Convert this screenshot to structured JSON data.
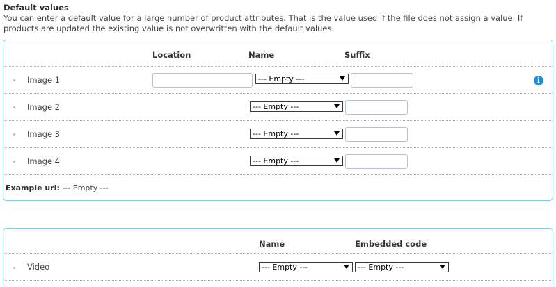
{
  "defaults": {
    "title": "Default values",
    "description": "You can enter a default value for a large number of product attributes. That is the value used if the file does not assign a value. If products are updated the existing value is not overwritten with the default values."
  },
  "images_panel": {
    "columns": {
      "location": "Location",
      "name": "Name",
      "suffix": "Suffix"
    },
    "rows": [
      {
        "label": "Image 1",
        "name_value": "--- Empty ---",
        "location_value": "",
        "suffix_value": ""
      },
      {
        "label": "Image 2",
        "name_value": "--- Empty ---",
        "suffix_value": ""
      },
      {
        "label": "Image 3",
        "name_value": "--- Empty ---",
        "suffix_value": ""
      },
      {
        "label": "Image 4",
        "name_value": "--- Empty ---",
        "suffix_value": ""
      }
    ],
    "example_label": "Example url:",
    "example_value": "--- Empty ---",
    "info_icon": "info-icon",
    "accent_color": "#1e8ed6",
    "border_color": "#7ccde6"
  },
  "video_panel": {
    "columns": {
      "name": "Name",
      "embedded_code": "Embedded code"
    },
    "row": {
      "label": "Video",
      "name_value": "--- Empty ---",
      "embedded_value": "--- Empty ---"
    }
  }
}
